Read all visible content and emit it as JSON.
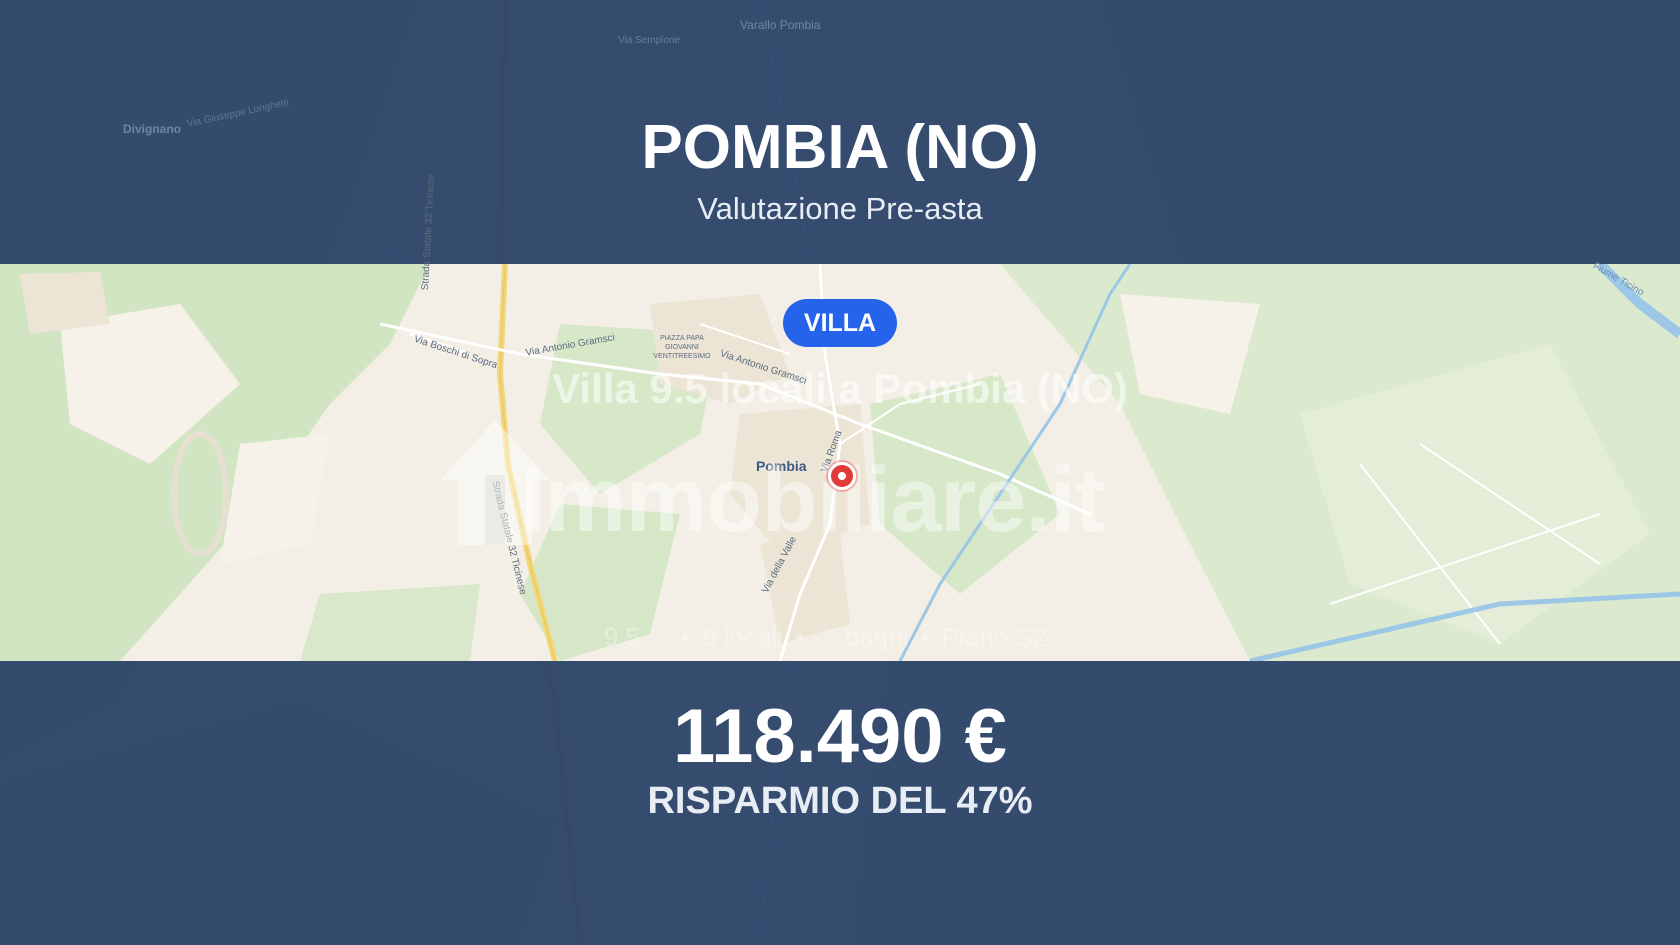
{
  "header": {
    "city": "POMBIA (NO)",
    "subtitle": "Valutazione Pre-asta"
  },
  "listing": {
    "type_badge": "VILLA",
    "title": "Villa 9.5 locali a Pombia (NO)",
    "features": [
      "9.5 ...",
      "9 locali",
      "... bagni",
      "Piano S2 ..."
    ]
  },
  "watermark": {
    "brand": "Immobiliare.it"
  },
  "map": {
    "marker_label": "Pombia",
    "labels": {
      "varallo": "Varallo Pombia",
      "via_sempione": "Via Sempione",
      "divignano": "Divignano",
      "via_giuseppe": "Via Giuseppe Longhetti",
      "strada_top": "Strada Statale 32 Ticinese",
      "via_boschi": "Via Boschi di Sopra",
      "via_gramsci": "Via Antonio Gramsci",
      "piazza": "PIAZZA PAPA GIOVANNI VENTITREESIMO",
      "via_gramsci2": "Via Antonio Gramsci",
      "via_roma": "Via Roma",
      "strada_mid": "Strada Statale 32 Ticinese",
      "via_valle": "Via della Valle",
      "fiume": "Fiume Ticino"
    },
    "colors": {
      "land": "#f3efe6",
      "green": "#d3e6c5",
      "water": "#9cc7e6",
      "marker": "#e23b3b"
    }
  },
  "footer": {
    "price": "118.490 €",
    "savings": "RISPARMIO DEL 47%"
  },
  "colors": {
    "band": "#284066",
    "badge": "#2563eb"
  }
}
